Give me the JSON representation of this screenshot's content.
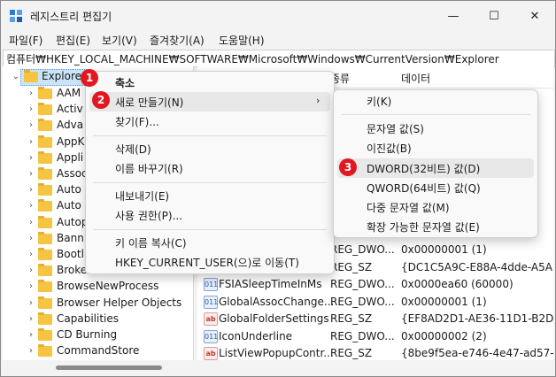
{
  "window": {
    "title": "레지스트리 편집기",
    "controls": {
      "minimize": "—",
      "maximize": "☐",
      "close": "✕"
    }
  },
  "menu": [
    "파일(F)",
    "편집(E)",
    "보기(V)",
    "즐겨찾기(A)",
    "도움말(H)"
  ],
  "address": "컴퓨터₩HKEY_LOCAL_MACHINE₩SOFTWARE₩Microsoft₩Windows₩CurrentVersion₩Explorer",
  "tree": {
    "selected": "Explorer",
    "children": [
      "AAM",
      "Activ",
      "Adva",
      "AppK",
      "Appli",
      "Assoc",
      "Auto",
      "Auto",
      "Autop",
      "Bann",
      "Bootl",
      "Broke",
      "BrowseNewProcess",
      "Browser Helper Objects",
      "Capabilities",
      "CD Burning",
      "CommandStore"
    ]
  },
  "list": {
    "headers": {
      "type": "종류",
      "data": "데이터"
    },
    "rows": [
      {
        "name": "",
        "type": "REG_DWO...",
        "data": "0x00000001 (1)",
        "icon": "binary"
      },
      {
        "name": "",
        "type": "REG_SZ",
        "data": "{DC1C5A9C-E88A-4dde-A5A",
        "icon": "string"
      },
      {
        "name": "FSIASleepTimeInMs",
        "type": "REG_DWO...",
        "data": "0x0000ea60 (60000)",
        "icon": "binary"
      },
      {
        "name": "GlobalAssocChange...",
        "type": "REG_DWO...",
        "data": "0x00000001 (1)",
        "icon": "binary"
      },
      {
        "name": "GlobalFolderSettings",
        "type": "REG_SZ",
        "data": "{EF8AD2D1-AE36-11D1-B2D",
        "icon": "string"
      },
      {
        "name": "IconUnderline",
        "type": "REG_DWO...",
        "data": "0x00000002 (2)",
        "icon": "binary"
      },
      {
        "name": "ListViewPopupContr...",
        "type": "REG_SZ",
        "data": "{8be9f5ea-e746-4e47-ad57-",
        "icon": "string"
      }
    ]
  },
  "context_menu": {
    "collapse": "축소",
    "new": "새로 만들기(N)",
    "find": "찾기(F)...",
    "delete": "삭제(D)",
    "rename": "이름 바꾸기(R)",
    "export": "내보내기(E)",
    "permissions": "사용 권한(P)...",
    "copy_key": "키 이름 복사(C)",
    "goto": "HKEY_CURRENT_USER(으)로 이동(T)"
  },
  "submenu": {
    "key": "키(K)",
    "string": "문자열 값(S)",
    "binary": "이진값(B)",
    "dword": "DWORD(32비트) 값(D)",
    "qword": "QWORD(64비트) 값(Q)",
    "multi": "다중 문자열 값(M)",
    "expand": "확장 가능한 문자열 값(E)"
  },
  "badges": [
    "1",
    "2",
    "3"
  ],
  "colors": {
    "badge": "#e1181f",
    "selection": "#cce4f7",
    "folder": "#f5c542"
  }
}
